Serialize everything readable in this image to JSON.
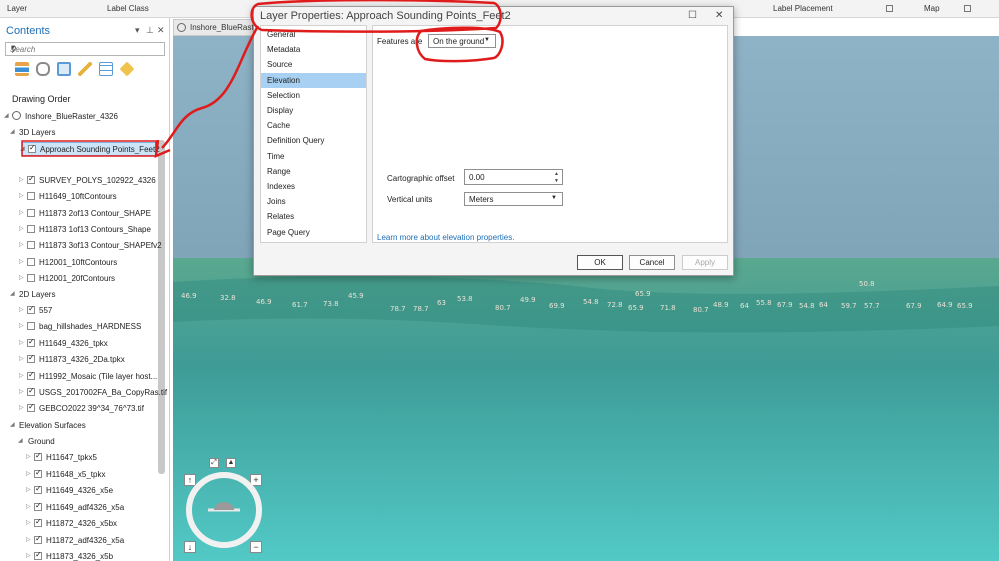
{
  "ribbon": {
    "layer": "Layer",
    "label_class": "Label Class",
    "label_placement": "Label Placement",
    "map": "Map"
  },
  "contents": {
    "title": "Contents",
    "search_placeholder": "Search",
    "drawing_order": "Drawing Order",
    "map_name": "Inshore_BlueRaster_4326",
    "groups": {
      "layers_3d": "3D Layers",
      "layers_2d": "2D Layers",
      "elevation": "Elevation Surfaces",
      "ground": "Ground"
    },
    "items_3d": [
      {
        "label": "Approach Sounding Points_Feet2",
        "checked": true,
        "selected": true
      },
      {
        "label": "SURVEY_POLYS_102922_4326",
        "checked": true
      },
      {
        "label": "H11649_10ftContours",
        "checked": false
      },
      {
        "label": "H11873 2of13 Contour_SHAPE",
        "checked": false
      },
      {
        "label": "H11873 1of13 Contours_Shape",
        "checked": false
      },
      {
        "label": "H11873 3of13 Contour_SHAPEfv2",
        "checked": false
      },
      {
        "label": "H12001_10ftContours",
        "checked": false
      },
      {
        "label": "H12001_20fContours",
        "checked": false
      }
    ],
    "items_2d": [
      {
        "label": "557",
        "checked": true
      },
      {
        "label": "bag_hillshades_HARDNESS",
        "checked": false
      },
      {
        "label": "H11649_4326_tpkx",
        "checked": true
      },
      {
        "label": "H11873_4326_2Da.tpkx",
        "checked": true
      },
      {
        "label": "H11992_Mosaic (Tile layer host...",
        "checked": true
      },
      {
        "label": "USGS_2017002FA_Ba_CopyRas.tif",
        "checked": true
      },
      {
        "label": "GEBCO2022 39^34_76^73.tif",
        "checked": true
      }
    ],
    "items_ground": [
      {
        "label": "H11647_tpkx5",
        "checked": true
      },
      {
        "label": "H11648_x5_tpkx",
        "checked": true
      },
      {
        "label": "H11649_4326_x5e",
        "checked": true
      },
      {
        "label": "H11649_adf4326_x5a",
        "checked": true
      },
      {
        "label": "H11872_4326_x5bx",
        "checked": true
      },
      {
        "label": "H11872_adf4326_x5a",
        "checked": true
      },
      {
        "label": "H11873_4326_x5b",
        "checked": true
      }
    ]
  },
  "map_tab": {
    "label": "Inshore_BlueRaste"
  },
  "dialog": {
    "title": "Layer Properties: Approach Sounding Points_Feet2",
    "nav": [
      "General",
      "Metadata",
      "Source",
      "Elevation",
      "Selection",
      "Display",
      "Cache",
      "Definition Query",
      "Time",
      "Range",
      "Indexes",
      "Joins",
      "Relates",
      "Page Query"
    ],
    "active_nav": "Elevation",
    "features_are_label": "Features are",
    "features_are_value": "On the ground",
    "offset_label": "Cartographic offset",
    "offset_value": "0.00",
    "units_label": "Vertical units",
    "units_value": "Meters",
    "learn_more": "Learn more about elevation properties.",
    "ok": "OK",
    "cancel": "Cancel",
    "apply": "Apply"
  },
  "soundings": [
    "46.9",
    "32.8",
    "46.9",
    "61.7",
    "73.8",
    "45.9",
    "78.7",
    "78.7",
    "63",
    "53.8",
    "80.7",
    "49.9",
    "69.9",
    "54.8",
    "72.8",
    "65.9",
    "65.9",
    "71.8",
    "80.7",
    "48.9",
    "64",
    "55.8",
    "67.9",
    "54.8",
    "64",
    "59.7",
    "57.7",
    "50.8",
    "67.9",
    "64.9",
    "65.9"
  ],
  "colors": {
    "annotation": "#e01b1b",
    "selection": "#a8d0f2",
    "link": "#1d6fb8",
    "water": "#3aa8a2"
  }
}
